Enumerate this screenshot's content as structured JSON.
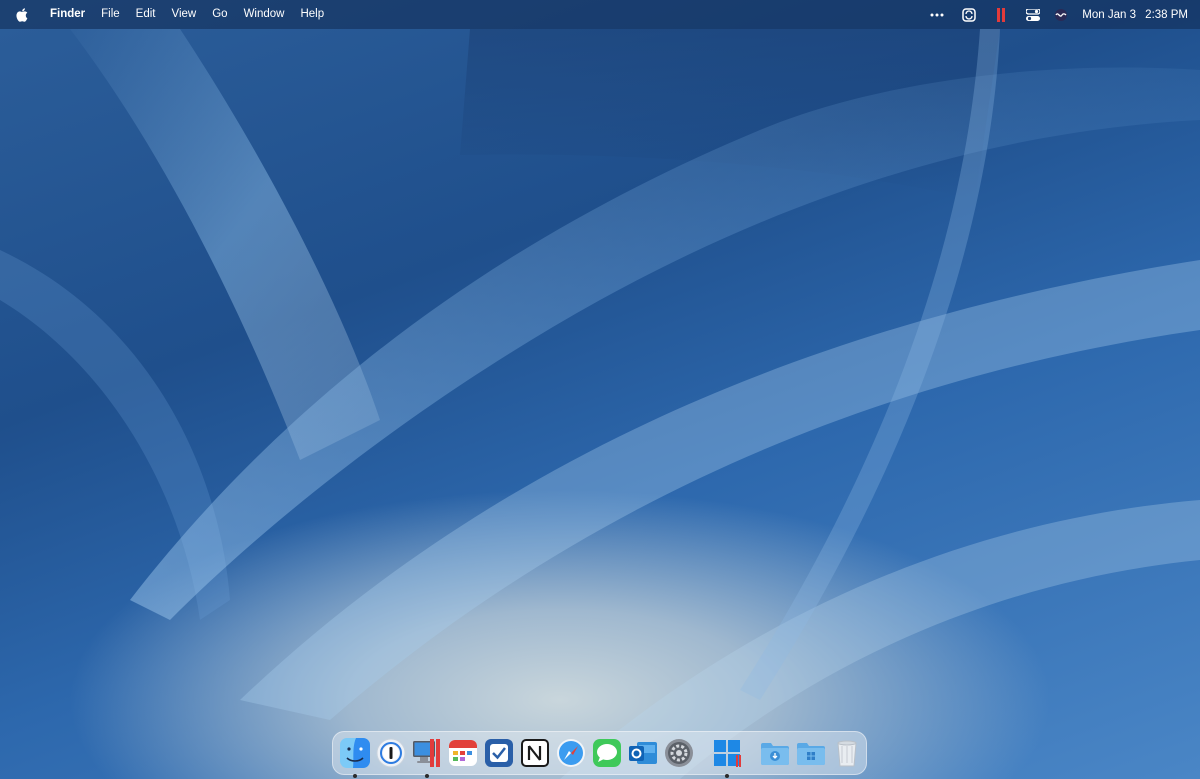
{
  "menubar": {
    "apple_icon": "apple-logo-icon",
    "app_name": "Finder",
    "menus": [
      "File",
      "Edit",
      "View",
      "Go",
      "Window",
      "Help"
    ],
    "status_icons": [
      "more-dots-icon",
      "sync-icon",
      "parallels-icon",
      "control-center-icon",
      "siri-icon"
    ],
    "date": "Mon Jan 3",
    "time": "2:38 PM"
  },
  "dock": {
    "apps": [
      {
        "name": "Finder",
        "icon": "finder-icon",
        "running": true
      },
      {
        "name": "1Password",
        "icon": "1password-icon",
        "running": false
      },
      {
        "name": "Parallels Desktop",
        "icon": "parallels-desktop-icon",
        "running": true
      },
      {
        "name": "Fantastical",
        "icon": "calendar-icon",
        "running": false
      },
      {
        "name": "OmniFocus",
        "icon": "tasks-checkbox-icon",
        "running": false
      },
      {
        "name": "Notion",
        "icon": "notion-icon",
        "running": false
      },
      {
        "name": "Safari",
        "icon": "safari-compass-icon",
        "running": false
      },
      {
        "name": "Messages",
        "icon": "messages-icon",
        "running": false
      },
      {
        "name": "Outlook",
        "icon": "outlook-icon",
        "running": false
      },
      {
        "name": "System Preferences",
        "icon": "gear-icon",
        "running": false
      },
      {
        "name": "Windows 11",
        "icon": "windows-icon",
        "running": true
      },
      {
        "name": "Downloads",
        "icon": "downloads-folder-icon",
        "running": false
      },
      {
        "name": "Windows Applications",
        "icon": "windows-folder-icon",
        "running": false
      },
      {
        "name": "Trash",
        "icon": "trash-icon",
        "running": false
      }
    ]
  },
  "colors": {
    "menubar_text": "#ffffff",
    "parallels_red": "#e23b3b",
    "finder_blue": "#2f8cf0",
    "folder_blue": "#5aa9e6"
  }
}
